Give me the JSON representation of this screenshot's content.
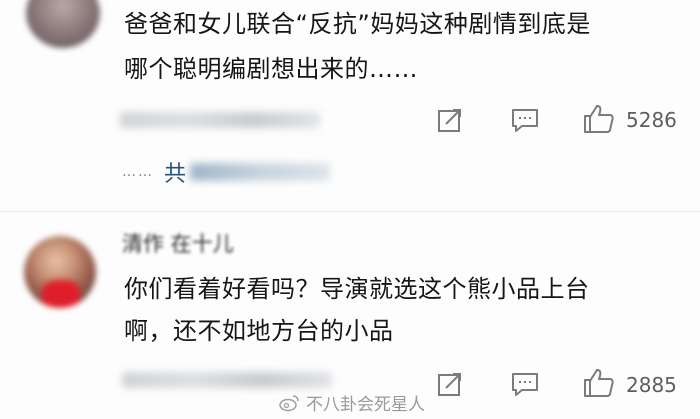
{
  "comments": [
    {
      "lines": [
        "爸爸和女儿联合“反抗”妈妈这种剧情到底是",
        "哪个聪明编剧想出来的……"
      ],
      "likes": "5286",
      "reply_dots": "……",
      "reply_prefix": "共"
    },
    {
      "username": "清作   在十儿",
      "lines": [
        "你们看着好看吗？导演就选这个熊小品上台",
        "啊，还不如地方台的小品"
      ],
      "likes": "2885"
    }
  ],
  "watermark": {
    "text": "不八卦会死星人"
  },
  "icons": [
    "share-icon",
    "comment-icon",
    "thumbs-up-icon",
    "weibo-logo-icon"
  ],
  "colors": {
    "text": "#161616",
    "icon": "#7b7b7b",
    "reply_link": "#29537a"
  }
}
